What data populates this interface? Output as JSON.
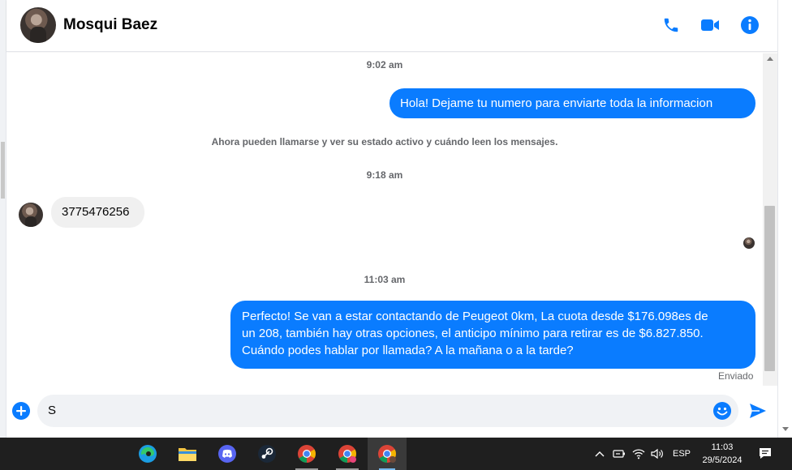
{
  "header": {
    "contact_name": "Mosqui Baez",
    "icons": [
      "phone-icon",
      "video-icon",
      "info-icon"
    ]
  },
  "colors": {
    "accent": "#0a7cff",
    "incoming_bubble": "#f0f0f0",
    "taskbar": "#1f1f1f"
  },
  "conversation": {
    "time_1": "9:02 am",
    "msg_1": "Hola! Dejame tu numero para enviarte toda la informacion",
    "notice": "Ahora pueden llamarse y ver su estado activo y cuándo leen los mensajes.",
    "time_2": "9:18 am",
    "msg_2": "3775476256",
    "time_3": "11:03 am",
    "msg_3_line_1": "Perfecto!  Se van a estar contactando de Peugeot 0km, La cuota desde $176.098es de",
    "msg_3_line_2": "un 208, también hay otras opciones, el anticipo mínimo para retirar es de $6.827.850.",
    "msg_3_line_3": "Cuándo podes hablar por llamada? A la mañana o a la tarde?",
    "status": "Enviado"
  },
  "composer": {
    "input_value": "S"
  },
  "taskbar": {
    "apps": [
      "edge-icon",
      "file-explorer-icon",
      "discord-icon",
      "steam-icon",
      "chrome-icon",
      "chrome-icon",
      "chrome-icon"
    ],
    "language": "ESP",
    "time": "11:03",
    "date": "29/5/2024"
  }
}
